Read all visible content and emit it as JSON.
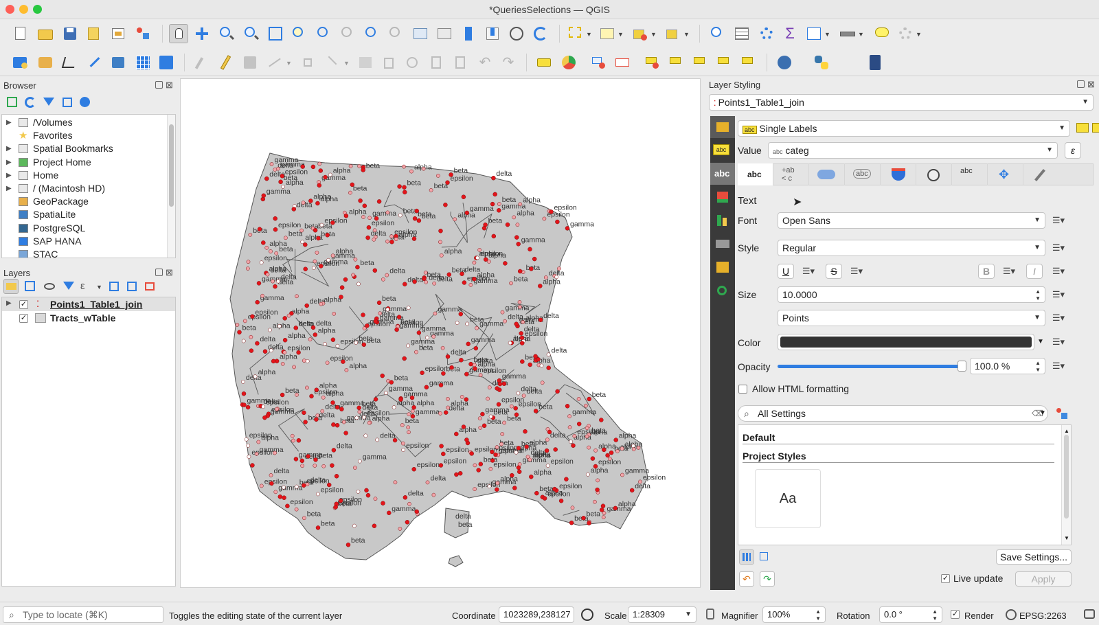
{
  "window": {
    "title": "*QueriesSelections — QGIS"
  },
  "colors": {
    "accent": "#2f7de1",
    "point_red": "#e3141a",
    "point_pink": "#f2a3a8",
    "polygon_fill": "#c8c8c8"
  },
  "browser": {
    "title": "Browser",
    "items": [
      {
        "label": "/Volumes",
        "icon": "folder-icon",
        "expandable": true
      },
      {
        "label": "Favorites",
        "icon": "star-icon",
        "expandable": false
      },
      {
        "label": "Spatial Bookmarks",
        "icon": "folder-icon",
        "expandable": true
      },
      {
        "label": "Project Home",
        "icon": "project-folder-icon",
        "expandable": true
      },
      {
        "label": "Home",
        "icon": "folder-icon",
        "expandable": true
      },
      {
        "label": "/ (Macintosh HD)",
        "icon": "folder-icon",
        "expandable": true
      },
      {
        "label": "GeoPackage",
        "icon": "geopackage-icon",
        "expandable": false
      },
      {
        "label": "SpatiaLite",
        "icon": "spatialite-icon",
        "expandable": false
      },
      {
        "label": "PostgreSQL",
        "icon": "postgresql-icon",
        "expandable": false
      },
      {
        "label": "SAP HANA",
        "icon": "saphana-icon",
        "expandable": false
      },
      {
        "label": "STAC",
        "icon": "stac-icon",
        "expandable": false
      }
    ]
  },
  "layers": {
    "title": "Layers",
    "items": [
      {
        "label": "Points1_Table1_join",
        "checked": true,
        "active": true
      },
      {
        "label": "Tracts_wTable",
        "checked": true,
        "active": false
      }
    ]
  },
  "map": {
    "labels": [
      "delta",
      "beta",
      "gamma",
      "alpha",
      "epsilon"
    ]
  },
  "styling": {
    "title": "Layer Styling",
    "layer_select": "Points1_Table1_join",
    "mode": "Single Labels",
    "value_label": "Value",
    "value_type": "abc",
    "value": "categ",
    "section": "Text",
    "font_label": "Font",
    "font": "Open Sans",
    "style_label": "Style",
    "style": "Regular",
    "underline": "U",
    "strike": "S",
    "bold": "B",
    "italic": "I",
    "size_label": "Size",
    "size": "10.0000",
    "size_unit": "Points",
    "color_label": "Color",
    "text_color": "#333333",
    "opacity_label": "Opacity",
    "opacity": "100.0 %",
    "opacity_fraction": 1.0,
    "allow_html": "Allow HTML formatting",
    "search_placeholder": "All Settings",
    "style_groups": [
      "Default",
      "Project Styles"
    ],
    "style_preview": "Aa",
    "save_settings": "Save Settings...",
    "live_update": "Live update",
    "apply": "Apply"
  },
  "statusbar": {
    "locate_placeholder": "Type to locate (⌘K)",
    "message": "Toggles the editing state of the current layer",
    "coordinate_label": "Coordinate",
    "coordinate": "1023289,238127",
    "scale_label": "Scale",
    "scale": "1:28309",
    "magnifier_label": "Magnifier",
    "magnifier": "100%",
    "rotation_label": "Rotation",
    "rotation": "0.0 °",
    "render_label": "Render",
    "crs": "EPSG:2263"
  }
}
